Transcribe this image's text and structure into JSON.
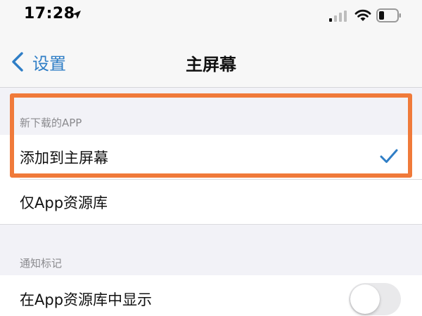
{
  "status_bar": {
    "time": "17:28",
    "location_icon": "location-arrow-icon",
    "signal_icon": "cellular-signal-icon",
    "wifi_icon": "wifi-icon",
    "battery_icon": "battery-low-icon"
  },
  "nav": {
    "back_label": "设置",
    "back_icon": "chevron-left-icon",
    "title": "主屏幕"
  },
  "sections": [
    {
      "header": "新下载的APP",
      "options": [
        {
          "label": "添加到主屏幕",
          "selected": true
        },
        {
          "label": "仅App资源库",
          "selected": false
        }
      ]
    },
    {
      "header": "通知标记",
      "rows": [
        {
          "label": "在App资源库中显示",
          "toggle_on": false
        }
      ]
    }
  ],
  "colors": {
    "accent_blue": "#2f7ec6",
    "highlight_orange": "#f07a3a",
    "background_gray": "#f2f2f7",
    "toggle_off": "#e9e9eb"
  }
}
